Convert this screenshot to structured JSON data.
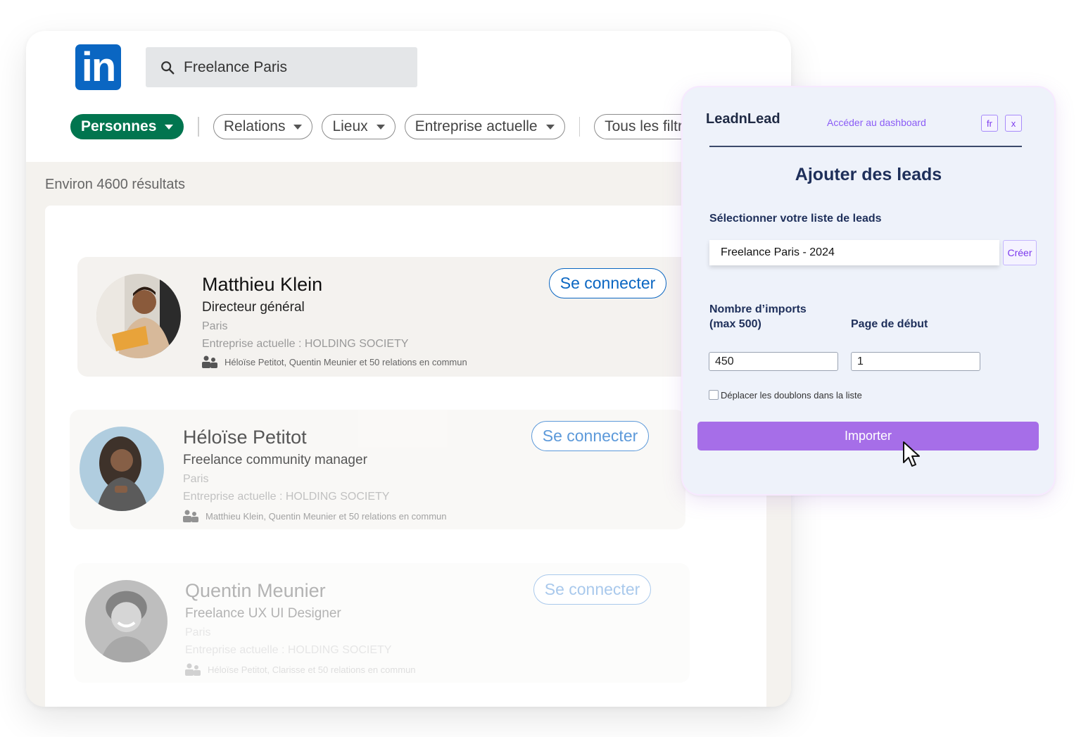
{
  "linkedin": {
    "logo_text": "in",
    "search": {
      "value": "Freelance Paris"
    },
    "filters": [
      {
        "label": "Personnes",
        "active": true
      },
      {
        "label": "Relations"
      },
      {
        "label": "Lieux"
      },
      {
        "label": "Entreprise actuelle"
      },
      {
        "label": "Tous les filtre"
      }
    ],
    "results_count": "Environ 4600 résultats",
    "connect_label": "Se connecter",
    "profiles": [
      {
        "name": "Matthieu Klein",
        "role": "Directeur général",
        "location": "Paris",
        "company": "Entreprise actuelle : HOLDING SOCIETY",
        "mutual": "Héloïse Petitot, Quentin Meunier et 50 relations en commun"
      },
      {
        "name": "Héloïse Petitot",
        "role": "Freelance community manager",
        "location": "Paris",
        "company": "Entreprise actuelle : HOLDING SOCIETY",
        "mutual": "Matthieu Klein, Quentin Meunier et 50 relations en commun"
      },
      {
        "name": "Quentin Meunier",
        "role": "Freelance UX UI Designer",
        "location": "Paris",
        "company": "Entreprise actuelle : HOLDING SOCIETY",
        "mutual": "Héloïse Petitot, Clarisse et 50 relations en commun"
      }
    ],
    "colors": {
      "brand": "#0a66c2",
      "active_filter": "#01754f"
    }
  },
  "leadnlead": {
    "brand": "LeadnLead",
    "dashboard_link": "Accéder au dashboard",
    "lang_button": "fr",
    "close_button": "x",
    "title": "Ajouter des leads",
    "list_label": "Sélectionner votre liste de leads",
    "list_value": "Freelance Paris - 2024",
    "create_button": "Créer",
    "imports_label_line1": "Nombre d’imports",
    "imports_label_line2": "(max 500)",
    "imports_value": "450",
    "start_page_label": "Page de début",
    "start_page_value": "1",
    "duplicates_label": "Déplacer les doublons dans la liste",
    "import_button": "Importer",
    "colors": {
      "accent": "#a66ee8",
      "title": "#1e2f5a"
    }
  }
}
